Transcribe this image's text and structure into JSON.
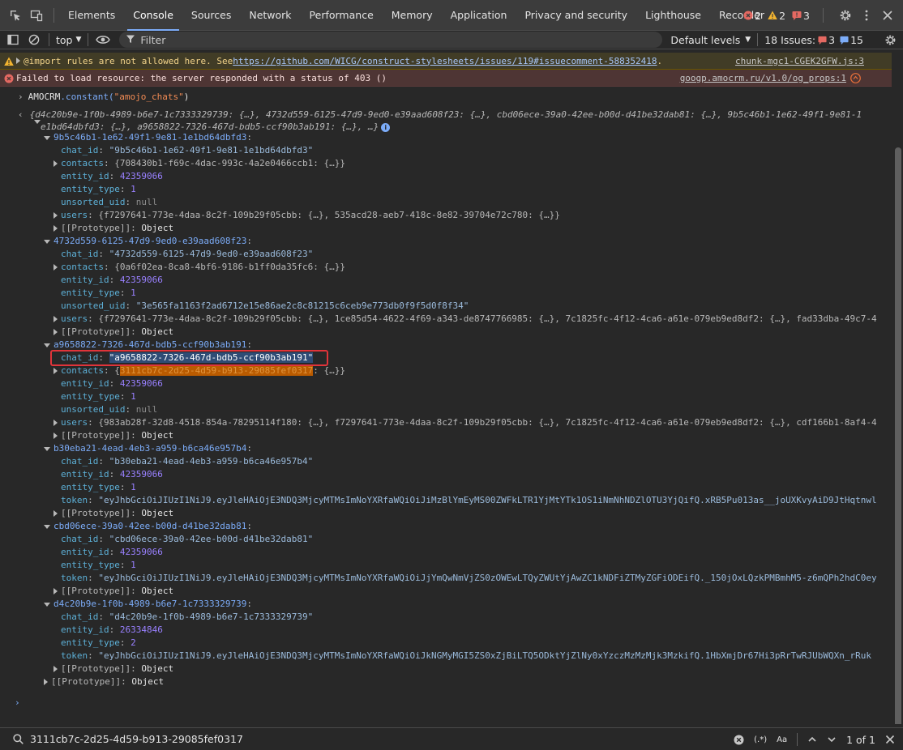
{
  "tabs": [
    "Elements",
    "Console",
    "Sources",
    "Network",
    "Performance",
    "Memory",
    "Application",
    "Privacy and security",
    "Lighthouse",
    "Recorder"
  ],
  "active_tab": "Console",
  "counts": {
    "errors": "2",
    "warnings": "2",
    "issues": "3"
  },
  "toolbar": {
    "context": "top",
    "filter_placeholder": "Filter",
    "levels": "Default levels",
    "issues_label": "18 Issues:",
    "issues_err": "3",
    "issues_info": "15"
  },
  "messages": {
    "warn_text_pre": "@import rules are not allowed here. See ",
    "warn_link": "https://github.com/WICG/construct-stylesheets/issues/119#issuecomment-588352418",
    "warn_text_post": ".",
    "warn_source": "chunk-mgc1-CGEK2GFW.js:3",
    "err_text": "Failed to load resource: the server responded with a status of 403 ()",
    "err_source": "googp.amocrm.ru/v1.0/og_props:1"
  },
  "command": {
    "obj": "AMOCRM",
    "method": ".constant(",
    "arg": "\"amojo_chats\"",
    "close": ")"
  },
  "result_preview_1": "{d4c20b9e-1f0b-4989-b6e7-1c7333329739: {…}, 4732d559-6125-47d9-9ed0-e39aad608f23: {…}, cbd06ece-39a0-42ee-b00d-d41be32dab81: {…}, 9b5c46b1-1e62-49f1-9e81-1",
  "result_preview_2": "e1bd64dbfd3: {…}, a9658822-7326-467d-bdb5-ccf90b3ab191: {…}, …}",
  "tree": [
    {
      "indent": 54,
      "tri": "d",
      "k": "9b5c46b1-1e62-49f1-9e81-1e1bd64dbfd3",
      "c": ":"
    },
    {
      "indent": 66,
      "tri": "",
      "p": "chat_id",
      "s": "\"9b5c46b1-1e62-49f1-9e81-1e1bd64dbfd3\""
    },
    {
      "indent": 66,
      "tri": "r",
      "p": "contacts",
      "d": "{708430b1-f69c-4dac-993c-4a2e0466ccb1: {…}}"
    },
    {
      "indent": 66,
      "tri": "",
      "p": "entity_id",
      "n": "42359066"
    },
    {
      "indent": 66,
      "tri": "",
      "p": "entity_type",
      "n": "1"
    },
    {
      "indent": 66,
      "tri": "",
      "p": "unsorted_uid",
      "nl": "null"
    },
    {
      "indent": 66,
      "tri": "r",
      "p": "users",
      "d": "{f7297641-773e-4daa-8c2f-109b29f05cbb: {…}, 535acd28-aeb7-418c-8e82-39704e72c780: {…}}"
    },
    {
      "indent": 66,
      "tri": "r",
      "p": "[[Prototype]]",
      "dp": true,
      "o": "Object"
    },
    {
      "indent": 54,
      "tri": "d",
      "k": "4732d559-6125-47d9-9ed0-e39aad608f23",
      "c": ":"
    },
    {
      "indent": 66,
      "tri": "",
      "p": "chat_id",
      "s": "\"4732d559-6125-47d9-9ed0-e39aad608f23\""
    },
    {
      "indent": 66,
      "tri": "r",
      "p": "contacts",
      "d": "{0a6f02ea-8ca8-4bf6-9186-b1ff0da35fc6: {…}}"
    },
    {
      "indent": 66,
      "tri": "",
      "p": "entity_id",
      "n": "42359066"
    },
    {
      "indent": 66,
      "tri": "",
      "p": "entity_type",
      "n": "1"
    },
    {
      "indent": 66,
      "tri": "",
      "p": "unsorted_uid",
      "s": "\"3e565fa1163f2ad6712e15e86ae2c8c81215c6ceb9e773db0f9f5d0f8f34\""
    },
    {
      "indent": 66,
      "tri": "r",
      "p": "users",
      "d": "{f7297641-773e-4daa-8c2f-109b29f05cbb: {…}, 1ce85d54-4622-4f69-a343-de8747766985: {…}, 7c1825fc-4f12-4ca6-a61e-079eb9ed8df2: {…}, fad33dba-49c7-4"
    },
    {
      "indent": 66,
      "tri": "r",
      "p": "[[Prototype]]",
      "dp": true,
      "o": "Object"
    },
    {
      "indent": 54,
      "tri": "d",
      "k": "a9658822-7326-467d-bdb5-ccf90b3ab191",
      "c": ":"
    },
    {
      "indent": 66,
      "tri": "",
      "p": "chat_id",
      "s": "\"a9658822-7326-467d-bdb5-ccf90b3ab191\"",
      "selected": true
    },
    {
      "indent": 66,
      "tri": "r",
      "p": "contacts",
      "d_pre": "{",
      "d_hl": "3111cb7c-2d25-4d59-b913-29085fef0317",
      "d_post": ": {…}}"
    },
    {
      "indent": 66,
      "tri": "",
      "p": "entity_id",
      "n": "42359066"
    },
    {
      "indent": 66,
      "tri": "",
      "p": "entity_type",
      "n": "1"
    },
    {
      "indent": 66,
      "tri": "",
      "p": "unsorted_uid",
      "nl": "null"
    },
    {
      "indent": 66,
      "tri": "r",
      "p": "users",
      "d": "{983ab28f-32d8-4518-854a-78295114f180: {…}, f7297641-773e-4daa-8c2f-109b29f05cbb: {…}, 7c1825fc-4f12-4ca6-a61e-079eb9ed8df2: {…}, cdf166b1-8af4-4"
    },
    {
      "indent": 66,
      "tri": "r",
      "p": "[[Prototype]]",
      "dp": true,
      "o": "Object"
    },
    {
      "indent": 54,
      "tri": "d",
      "k": "b30eba21-4ead-4eb3-a959-b6ca46e957b4",
      "c": ":"
    },
    {
      "indent": 66,
      "tri": "",
      "p": "chat_id",
      "s": "\"b30eba21-4ead-4eb3-a959-b6ca46e957b4\""
    },
    {
      "indent": 66,
      "tri": "",
      "p": "entity_id",
      "n": "42359066"
    },
    {
      "indent": 66,
      "tri": "",
      "p": "entity_type",
      "n": "1"
    },
    {
      "indent": 66,
      "tri": "",
      "p": "token",
      "s": "\"eyJhbGciOiJIUzI1NiJ9.eyJleHAiOjE3NDQ3MjcyMTMsImNoYXRfaWQiOiJiMzBlYmEyMS00ZWFkLTR1YjMtYTk1OS1iNmNhNDZlOTU3YjQifQ.xRB5Pu013as__joUXKvyAiD9JtHqtnwl"
    },
    {
      "indent": 66,
      "tri": "r",
      "p": "[[Prototype]]",
      "dp": true,
      "o": "Object"
    },
    {
      "indent": 54,
      "tri": "d",
      "k": "cbd06ece-39a0-42ee-b00d-d41be32dab81",
      "c": ":"
    },
    {
      "indent": 66,
      "tri": "",
      "p": "chat_id",
      "s": "\"cbd06ece-39a0-42ee-b00d-d41be32dab81\""
    },
    {
      "indent": 66,
      "tri": "",
      "p": "entity_id",
      "n": "42359066"
    },
    {
      "indent": 66,
      "tri": "",
      "p": "entity_type",
      "n": "1"
    },
    {
      "indent": 66,
      "tri": "",
      "p": "token",
      "s": "\"eyJhbGciOiJIUzI1NiJ9.eyJleHAiOjE3NDQ3MjcyMTMsImNoYXRfaWQiOiJjYmQwNmVjZS0zOWEwLTQyZWUtYjAwZC1kNDFiZTMyZGFiODEifQ._150jOxLQzkPMBmhM5-z6mQPh2hdC0ey"
    },
    {
      "indent": 66,
      "tri": "r",
      "p": "[[Prototype]]",
      "dp": true,
      "o": "Object"
    },
    {
      "indent": 54,
      "tri": "d",
      "k": "d4c20b9e-1f0b-4989-b6e7-1c7333329739",
      "c": ":"
    },
    {
      "indent": 66,
      "tri": "",
      "p": "chat_id",
      "s": "\"d4c20b9e-1f0b-4989-b6e7-1c7333329739\""
    },
    {
      "indent": 66,
      "tri": "",
      "p": "entity_id",
      "n": "26334846"
    },
    {
      "indent": 66,
      "tri": "",
      "p": "entity_type",
      "n": "2"
    },
    {
      "indent": 66,
      "tri": "",
      "p": "token",
      "s": "\"eyJhbGciOiJIUzI1NiJ9.eyJleHAiOjE3NDQ3MjcyMTMsImNoYXRfaWQiOiJkNGMyMGI5ZS0xZjBiLTQ5ODktYjZlNy0xYzczMzMzMjk3MzkifQ.1HbXmjDr67Hi3pRrTwRJUbWQXn_rRuk"
    },
    {
      "indent": 66,
      "tri": "r",
      "p": "[[Prototype]]",
      "dp": true,
      "o": "Object"
    },
    {
      "indent": 54,
      "tri": "r",
      "p": "[[Prototype]]",
      "dp": true,
      "o": "Object"
    }
  ],
  "search": {
    "value": "3111cb7c-2d25-4d59-b913-29085fef0317",
    "regex": "(.*)",
    "case": "Aa",
    "result": "1 of 1"
  },
  "colors": {
    "accent": "#7cacf8",
    "error": "#e46962",
    "warning": "#f2b430",
    "highlight": "#ba5b00"
  }
}
